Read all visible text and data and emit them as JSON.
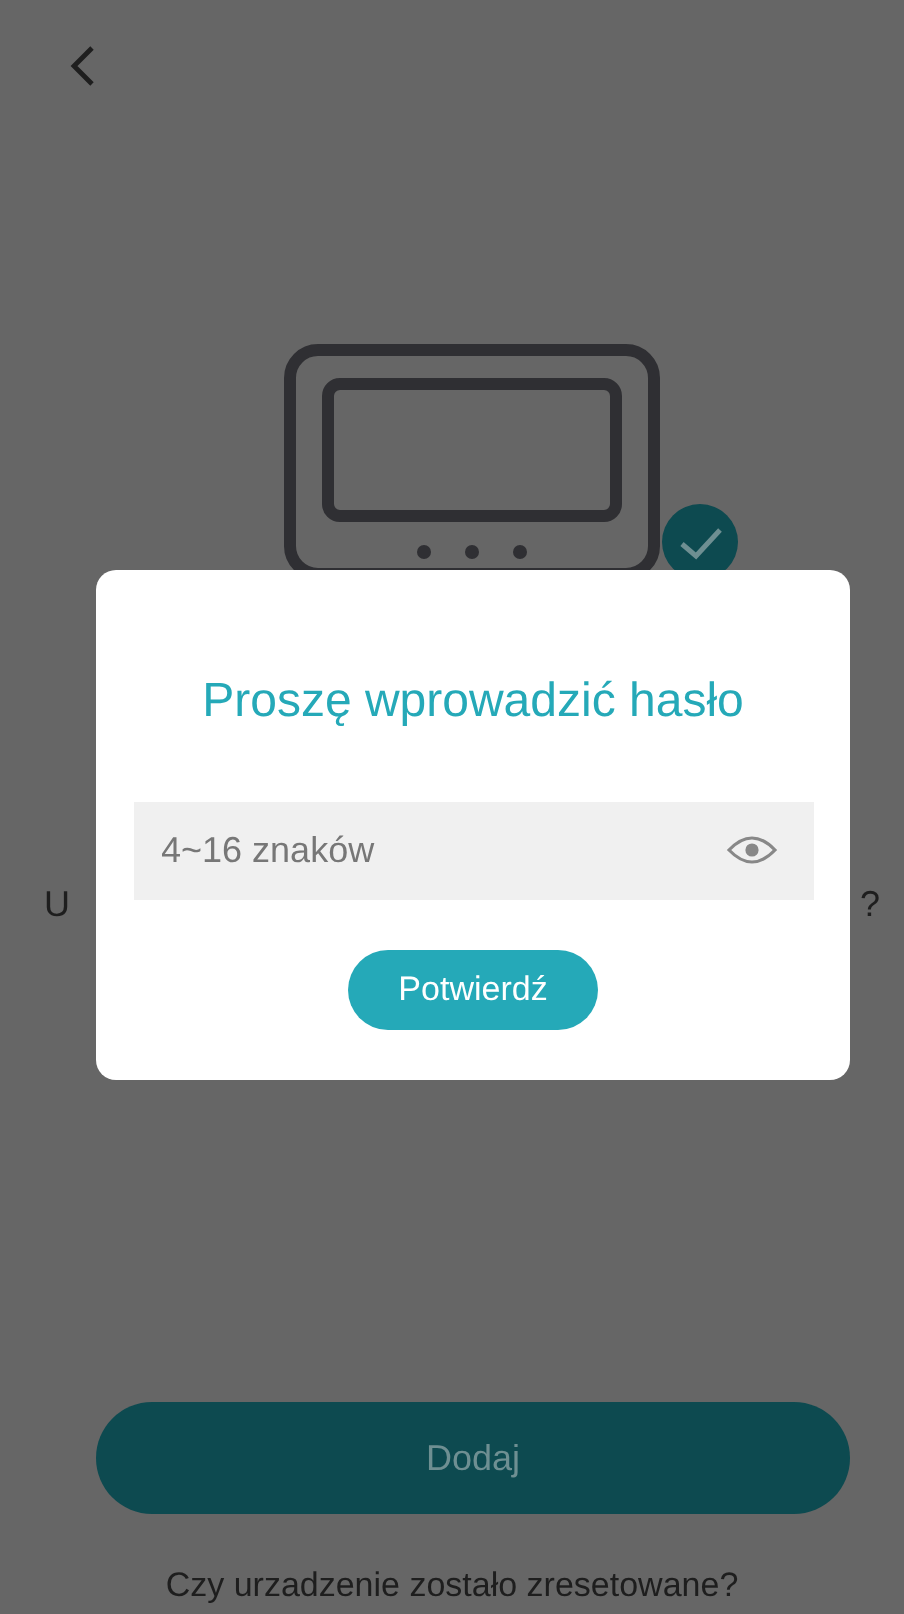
{
  "hint_fragments": [
    "U",
    "?"
  ],
  "add_button": {
    "label": "Dodaj",
    "disabled": true
  },
  "reset_link": "Czy urzadzenie zostało zresetowane?",
  "dialog": {
    "title": "Proszę wprowadzić hasło",
    "password": {
      "placeholder": "4~16 znaków"
    },
    "confirm_button": "Potwierdź"
  }
}
